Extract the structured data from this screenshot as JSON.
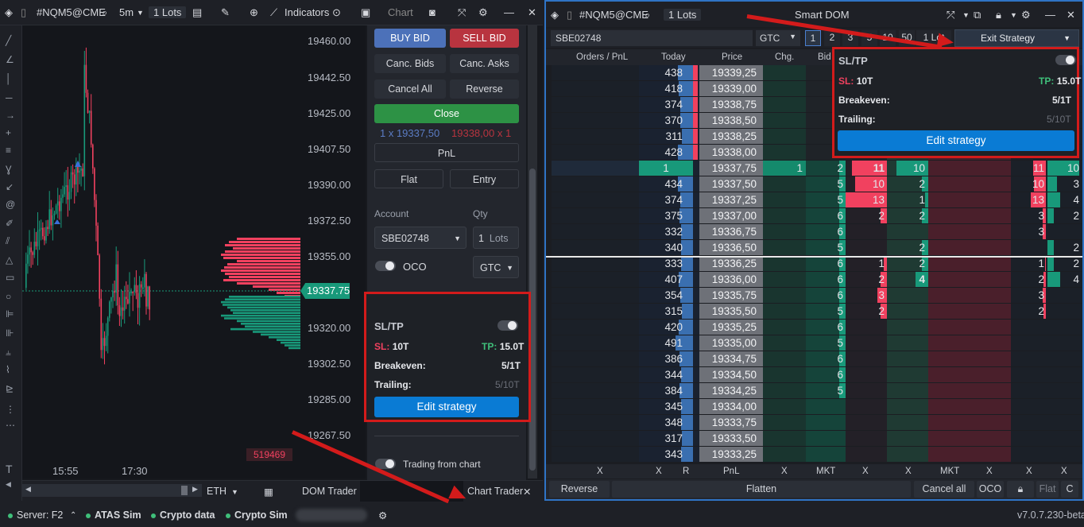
{
  "left_window": {
    "symbol": "#NQM5@CME",
    "timeframe": "5m",
    "qty_value": "1",
    "qty_unit": "Lots",
    "indicators_label": "Indicators",
    "chart_label": "Chart",
    "price_labels": [
      "19460.00",
      "19442.50",
      "19425.00",
      "19407.50",
      "19390.00",
      "19372.50",
      "19355.00",
      "19337.75",
      "19320.00",
      "19302.50",
      "19285.00",
      "19267.50"
    ],
    "current_price": "19337.75",
    "volume_label": "519469",
    "time_labels": [
      "15:55",
      "17:30"
    ],
    "bottom_symbol": "ETH",
    "tabs": [
      "DOM Trader",
      "Chart Trader"
    ]
  },
  "chart_trader": {
    "buy_bid": "BUY BID",
    "sell_bid": "SELL BID",
    "canc_bids": "Canc. Bids",
    "canc_asks": "Canc. Asks",
    "cancel_all": "Cancel All",
    "reverse": "Reverse",
    "close": "Close",
    "position_buy": "1 x 19337,50",
    "position_sell": "19338,00 x 1",
    "pnl": "PnL",
    "flat": "Flat",
    "entry": "Entry",
    "account_label": "Account",
    "qty_label": "Qty",
    "account_value": "SBE02748",
    "qty_value": "1",
    "qty_unit": "Lots",
    "oco_label": "OCO",
    "tif_value": "GTC",
    "trading_from_chart": "Trading from chart"
  },
  "sltp": {
    "title": "SL/TP",
    "sl_label": "SL:",
    "sl_value": "10T",
    "tp_label": "TP:",
    "tp_value": "15.0T",
    "breakeven_label": "Breakeven:",
    "breakeven_value": "5/1T",
    "trailing_label": "Trailing:",
    "trailing_value": "5/10T",
    "edit_button": "Edit strategy"
  },
  "right_window": {
    "symbol": "#NQM5@CME",
    "qty_value": "1",
    "qty_unit": "Lots",
    "title": "Smart DOM",
    "account": "SBE02748",
    "tif": "GTC",
    "qty_buttons": [
      "1",
      "2",
      "3",
      "5",
      "10",
      "50",
      "1 Lot"
    ],
    "exit_strategy": "Exit Strategy",
    "columns": [
      "Orders / PnL",
      "Today",
      "Price",
      "Chg.",
      "Bid"
    ],
    "bottom_row1": [
      "X",
      "X",
      "R",
      "PnL",
      "X",
      "MKT",
      "X",
      "X",
      "MKT",
      "X",
      "X",
      "X"
    ],
    "reverse": "Reverse",
    "flatten": "Flatten",
    "cancel_all": "Cancel all",
    "oco": "OCO",
    "flat": "Flat",
    "c": "C"
  },
  "dom_rows": [
    {
      "today": "438",
      "price": "19339,25",
      "bid": "",
      "ask": "",
      "ask2": "",
      "l1": "",
      "l2": ""
    },
    {
      "today": "418",
      "price": "19339,00",
      "bid": "",
      "ask": "",
      "ask2": "",
      "l1": "",
      "l2": ""
    },
    {
      "today": "374",
      "price": "19338,75",
      "bid": "",
      "ask": "",
      "ask2": "",
      "l1": "",
      "l2": ""
    },
    {
      "today": "370",
      "price": "19338,50",
      "bid": "",
      "ask": "",
      "ask2": "",
      "l1": "",
      "l2": ""
    },
    {
      "today": "311",
      "price": "19338,25",
      "bid": "",
      "ask": "",
      "ask2": "",
      "l1": "",
      "l2": ""
    },
    {
      "today": "428",
      "price": "19338,00",
      "bid": "",
      "ask": "",
      "ask2": "",
      "l1": "",
      "l2": ""
    },
    {
      "today": "1",
      "price": "19337,75",
      "chg": "1",
      "bid": "2",
      "ask": "11",
      "ask2": "10",
      "l1": "11",
      "l2": "10"
    },
    {
      "today": "434",
      "price": "19337,50",
      "bid": "5",
      "ask": "10",
      "ask2": "2",
      "l1": "10",
      "l2": "3"
    },
    {
      "today": "374",
      "price": "19337,25",
      "bid": "5",
      "ask": "13",
      "ask2": "1",
      "l1": "13",
      "l2": "4"
    },
    {
      "today": "375",
      "price": "19337,00",
      "bid": "6",
      "ask": "2",
      "ask2": "2",
      "l1": "3",
      "l2": "2"
    },
    {
      "today": "332",
      "price": "19336,75",
      "bid": "6",
      "ask": "",
      "ask2": "",
      "l1": "3",
      "l2": ""
    },
    {
      "today": "340",
      "price": "19336,50",
      "bid": "5",
      "ask": "",
      "ask2": "2",
      "l1": "",
      "l2": "2"
    },
    {
      "today": "333",
      "price": "19336,25",
      "bid": "6",
      "ask": "1",
      "ask2": "2",
      "l1": "1",
      "l2": "2"
    },
    {
      "today": "407",
      "price": "19336,00",
      "bid": "6",
      "ask": "2",
      "ask2": "4",
      "l1": "2",
      "l2": "4"
    },
    {
      "today": "354",
      "price": "19335,75",
      "bid": "6",
      "ask": "3",
      "ask2": "",
      "l1": "3",
      "l2": ""
    },
    {
      "today": "315",
      "price": "19335,50",
      "bid": "5",
      "ask": "2",
      "ask2": "",
      "l1": "2",
      "l2": ""
    },
    {
      "today": "420",
      "price": "19335,25",
      "bid": "6",
      "ask": "",
      "ask2": "",
      "l1": "",
      "l2": ""
    },
    {
      "today": "491",
      "price": "19335,00",
      "bid": "5",
      "ask": "",
      "ask2": "",
      "l1": "",
      "l2": ""
    },
    {
      "today": "386",
      "price": "19334,75",
      "bid": "6",
      "ask": "",
      "ask2": "",
      "l1": "",
      "l2": ""
    },
    {
      "today": "344",
      "price": "19334,50",
      "bid": "6",
      "ask": "",
      "ask2": "",
      "l1": "",
      "l2": ""
    },
    {
      "today": "384",
      "price": "19334,25",
      "bid": "5",
      "ask": "",
      "ask2": "",
      "l1": "",
      "l2": ""
    },
    {
      "today": "345",
      "price": "19334,00",
      "bid": "",
      "ask": "",
      "ask2": "",
      "l1": "",
      "l2": ""
    },
    {
      "today": "348",
      "price": "19333,75",
      "bid": "",
      "ask": "",
      "ask2": "",
      "l1": "",
      "l2": ""
    },
    {
      "today": "317",
      "price": "19333,50",
      "bid": "",
      "ask": "",
      "ask2": "",
      "l1": "",
      "l2": ""
    },
    {
      "today": "343",
      "price": "19333,25",
      "bid": "",
      "ask": "",
      "ask2": "",
      "l1": "",
      "l2": ""
    }
  ],
  "status_bar": {
    "server": "Server: F2",
    "items": [
      "ATAS Sim",
      "Crypto data",
      "Crypto Sim"
    ],
    "version": "v7.0.7.230-beta"
  },
  "colors": {
    "buy": "#18997a",
    "sell": "#f1415f",
    "accent": "#0a7bd4",
    "highlight": "#d31b1b"
  }
}
